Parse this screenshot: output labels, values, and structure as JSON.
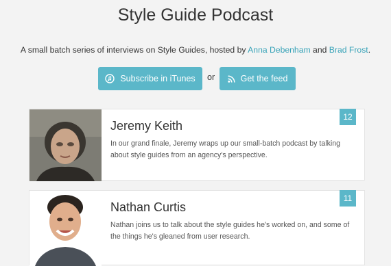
{
  "header": {
    "title": "Style Guide Podcast",
    "intro_prefix": "A small batch series of interviews on Style Guides, hosted by",
    "host1": "Anna Debenham",
    "intro_and": "and",
    "host2": "Brad Frost",
    "intro_suffix": "."
  },
  "actions": {
    "itunes_label": "Subscribe in iTunes",
    "itunes_icon": "music-note-icon",
    "or_text": "or",
    "feed_label": "Get the feed",
    "feed_icon": "rss-icon"
  },
  "colors": {
    "accent": "#5bb7c9",
    "link": "#38a3b8",
    "background": "#f3f3f3"
  },
  "episodes": [
    {
      "number": "12",
      "name": "Jeremy Keith",
      "description": "In our grand finale, Jeremy wraps up our small-batch podcast by talking about style guides from an agency's perspective."
    },
    {
      "number": "11",
      "name": "Nathan Curtis",
      "description": "Nathan joins us to talk about the style guides he's worked on, and some of the things he's gleaned from user research."
    }
  ]
}
